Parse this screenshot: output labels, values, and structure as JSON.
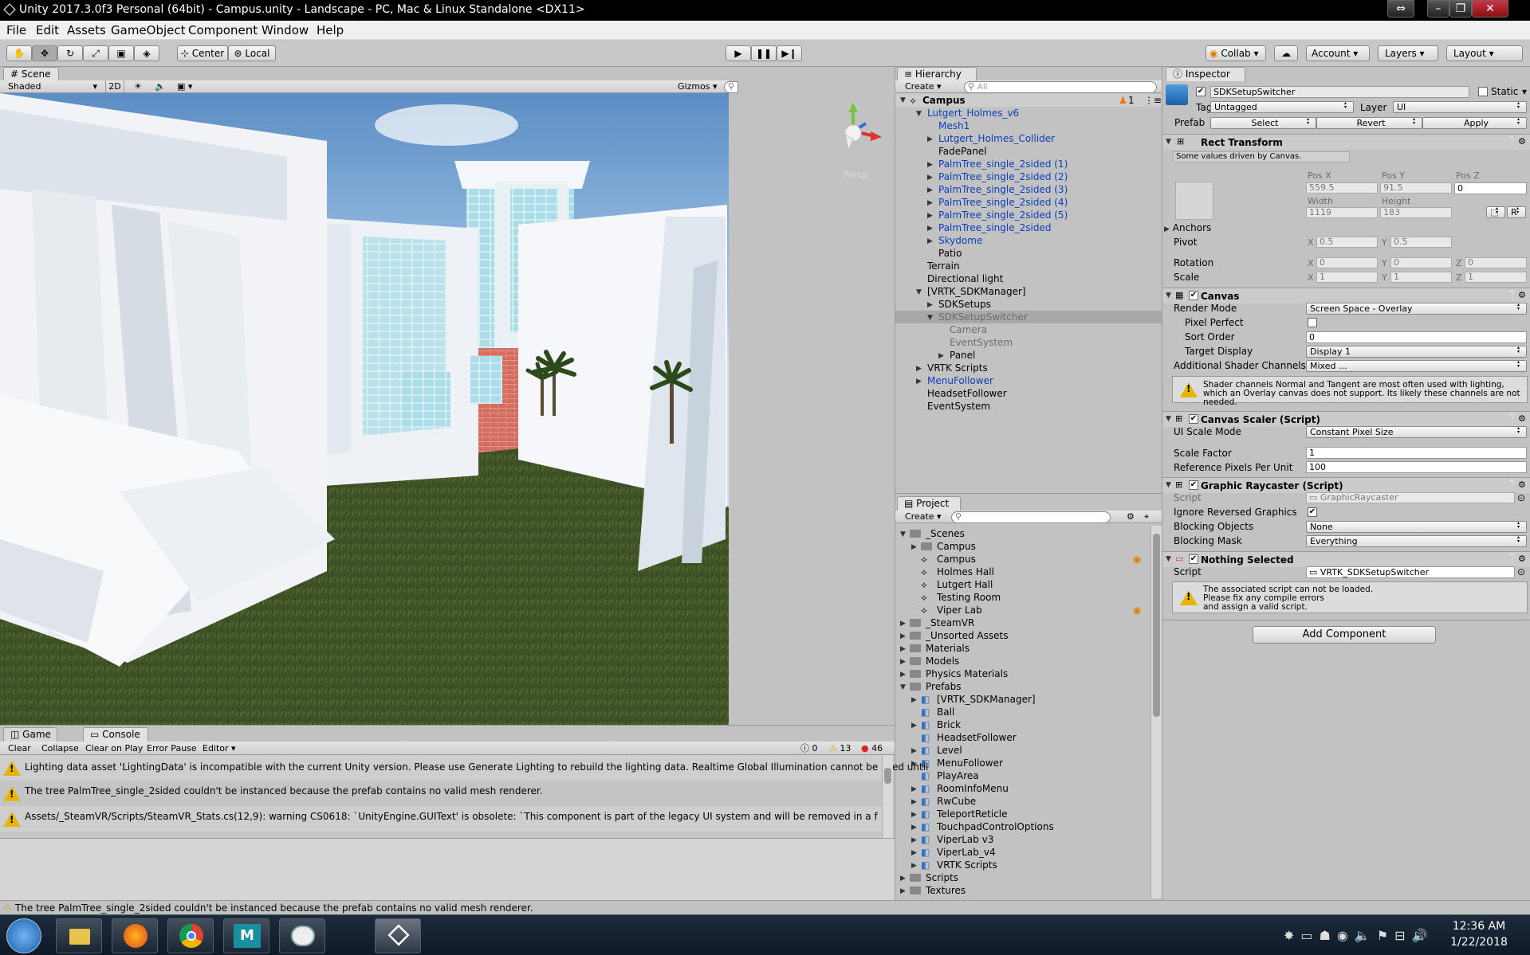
{
  "window": {
    "title": "Unity 2017.3.0f3 Personal (64bit) - Campus.unity - Landscape - PC, Mac & Linux Standalone <DX11>"
  },
  "menu": [
    "File",
    "Edit",
    "Assets",
    "GameObject",
    "Component",
    "Window",
    "Help"
  ],
  "toolbar": {
    "center": "Center",
    "local": "Local",
    "collab": "Collab",
    "account": "Account",
    "layers": "Layers",
    "layout": "Layout"
  },
  "scene": {
    "tab": "Scene",
    "shading": "Shaded",
    "mode2d": "2D",
    "gizmos": "Gizmos",
    "search": "All",
    "persp": "Persp"
  },
  "hierarchy": {
    "tab": "Hierarchy",
    "create": "Create",
    "search": "All",
    "scene_name": "Campus",
    "badge": "1",
    "items": [
      {
        "label": "Lutgert_Holmes_v6",
        "indent": 1,
        "arrow": "open",
        "color": "blue"
      },
      {
        "label": "Mesh1",
        "indent": 2,
        "arrow": "",
        "color": "blue"
      },
      {
        "label": "Lutgert_Holmes_Collider",
        "indent": 2,
        "arrow": "closed",
        "color": "blue"
      },
      {
        "label": "FadePanel",
        "indent": 2,
        "arrow": "",
        "color": "black"
      },
      {
        "label": "PalmTree_single_2sided (1)",
        "indent": 2,
        "arrow": "closed",
        "color": "blue"
      },
      {
        "label": "PalmTree_single_2sided (2)",
        "indent": 2,
        "arrow": "closed",
        "color": "blue"
      },
      {
        "label": "PalmTree_single_2sided (3)",
        "indent": 2,
        "arrow": "closed",
        "color": "blue"
      },
      {
        "label": "PalmTree_single_2sided (4)",
        "indent": 2,
        "arrow": "closed",
        "color": "blue"
      },
      {
        "label": "PalmTree_single_2sided (5)",
        "indent": 2,
        "arrow": "closed",
        "color": "blue"
      },
      {
        "label": "PalmTree_single_2sided",
        "indent": 2,
        "arrow": "closed",
        "color": "blue"
      },
      {
        "label": "Skydome",
        "indent": 2,
        "arrow": "closed",
        "color": "blue"
      },
      {
        "label": "Patio",
        "indent": 2,
        "arrow": "",
        "color": "black"
      },
      {
        "label": "Terrain",
        "indent": 1,
        "arrow": "",
        "color": "black"
      },
      {
        "label": "Directional light",
        "indent": 1,
        "arrow": "",
        "color": "black"
      },
      {
        "label": "[VRTK_SDKManager]",
        "indent": 1,
        "arrow": "open",
        "color": "black"
      },
      {
        "label": "SDKSetups",
        "indent": 2,
        "arrow": "closed",
        "color": "black"
      },
      {
        "label": "SDKSetupSwitcher",
        "indent": 2,
        "arrow": "open",
        "color": "gray",
        "selected": true
      },
      {
        "label": "Camera",
        "indent": 3,
        "arrow": "",
        "color": "gray"
      },
      {
        "label": "EventSystem",
        "indent": 3,
        "arrow": "",
        "color": "gray"
      },
      {
        "label": "Panel",
        "indent": 3,
        "arrow": "closed",
        "color": "black"
      },
      {
        "label": "VRTK Scripts",
        "indent": 1,
        "arrow": "closed",
        "color": "black"
      },
      {
        "label": "MenuFollower",
        "indent": 1,
        "arrow": "closed",
        "color": "blue"
      },
      {
        "label": "HeadsetFollower",
        "indent": 1,
        "arrow": "",
        "color": "black"
      },
      {
        "label": "EventSystem",
        "indent": 1,
        "arrow": "",
        "color": "black"
      }
    ]
  },
  "project": {
    "tab": "Project",
    "create": "Create",
    "items": [
      {
        "label": "_Scenes",
        "indent": 0,
        "arrow": "open",
        "icon": "folder"
      },
      {
        "label": "Campus",
        "indent": 1,
        "arrow": "closed",
        "icon": "folder"
      },
      {
        "label": "Campus",
        "indent": 1,
        "arrow": "",
        "icon": "unity",
        "collab": true
      },
      {
        "label": "Holmes Hall",
        "indent": 1,
        "arrow": "",
        "icon": "unity"
      },
      {
        "label": "Lutgert Hall",
        "indent": 1,
        "arrow": "",
        "icon": "unity"
      },
      {
        "label": "Testing Room",
        "indent": 1,
        "arrow": "",
        "icon": "unity"
      },
      {
        "label": "Viper Lab",
        "indent": 1,
        "arrow": "",
        "icon": "unity",
        "collab": true
      },
      {
        "label": "_SteamVR",
        "indent": 0,
        "arrow": "closed",
        "icon": "folder"
      },
      {
        "label": "_Unsorted Assets",
        "indent": 0,
        "arrow": "closed",
        "icon": "folder"
      },
      {
        "label": "Materials",
        "indent": 0,
        "arrow": "closed",
        "icon": "folder"
      },
      {
        "label": "Models",
        "indent": 0,
        "arrow": "closed",
        "icon": "folder"
      },
      {
        "label": "Physics Materials",
        "indent": 0,
        "arrow": "closed",
        "icon": "folder"
      },
      {
        "label": "Prefabs",
        "indent": 0,
        "arrow": "open",
        "icon": "folder"
      },
      {
        "label": "[VRTK_SDKManager]",
        "indent": 1,
        "arrow": "closed",
        "icon": "prefab"
      },
      {
        "label": "Ball",
        "indent": 1,
        "arrow": "",
        "icon": "prefab"
      },
      {
        "label": "Brick",
        "indent": 1,
        "arrow": "closed",
        "icon": "prefab"
      },
      {
        "label": "HeadsetFollower",
        "indent": 1,
        "arrow": "",
        "icon": "prefab"
      },
      {
        "label": "Level",
        "indent": 1,
        "arrow": "closed",
        "icon": "prefab"
      },
      {
        "label": "MenuFollower",
        "indent": 1,
        "arrow": "closed",
        "icon": "prefab"
      },
      {
        "label": "PlayArea",
        "indent": 1,
        "arrow": "",
        "icon": "prefab"
      },
      {
        "label": "RoomInfoMenu",
        "indent": 1,
        "arrow": "closed",
        "icon": "prefab"
      },
      {
        "label": "RwCube",
        "indent": 1,
        "arrow": "closed",
        "icon": "prefab"
      },
      {
        "label": "TeleportReticle",
        "indent": 1,
        "arrow": "closed",
        "icon": "prefab"
      },
      {
        "label": "TouchpadControlOptions",
        "indent": 1,
        "arrow": "closed",
        "icon": "prefab"
      },
      {
        "label": "ViperLab v3",
        "indent": 1,
        "arrow": "closed",
        "icon": "prefab"
      },
      {
        "label": "ViperLab_v4",
        "indent": 1,
        "arrow": "closed",
        "icon": "prefab"
      },
      {
        "label": "VRTK Scripts",
        "indent": 1,
        "arrow": "closed",
        "icon": "prefab"
      },
      {
        "label": "Scripts",
        "indent": 0,
        "arrow": "closed",
        "icon": "folder"
      },
      {
        "label": "Textures",
        "indent": 0,
        "arrow": "closed",
        "icon": "folder"
      }
    ]
  },
  "console": {
    "game_tab": "Game",
    "console_tab": "Console",
    "clear": "Clear",
    "collapse": "Collapse",
    "clear_on_play": "Clear on Play",
    "error_pause": "Error Pause",
    "editor": "Editor",
    "info_count": "0",
    "warn_count": "13",
    "error_count": "46",
    "messages": [
      "Lighting data asset 'LightingData' is incompatible with the current Unity version. Please use Generate Lighting to rebuild the lighting data.  Realtime Global Illumination cannot be used until",
      "The tree PalmTree_single_2sided couldn't be instanced because the prefab contains no valid mesh renderer.",
      "Assets/_SteamVR/Scripts/SteamVR_Stats.cs(12,9): warning CS0618: `UnityEngine.GUIText' is obsolete: `This component is part of the legacy UI system and will be removed in a future r"
    ]
  },
  "inspector": {
    "tab": "Inspector",
    "object_name": "SDKSetupSwitcher",
    "static": "Static",
    "tag_label": "Tag",
    "tag": "Untagged",
    "layer_label": "Layer",
    "layer": "UI",
    "prefab_label": "Prefab",
    "select": "Select",
    "revert": "Revert",
    "apply": "Apply",
    "rect": {
      "title": "Rect Transform",
      "note": "Some values driven by Canvas.",
      "posx_label": "Pos X",
      "posy_label": "Pos Y",
      "posz_label": "Pos Z",
      "posx": "559.5",
      "posy": "91.5",
      "posz": "0",
      "width_label": "Width",
      "height_label": "Height",
      "width": "1119",
      "height": "183",
      "anchors": "Anchors",
      "pivot": "Pivot",
      "pivot_x": "0.5",
      "pivot_y": "0.5",
      "rotation": "Rotation",
      "rot_x": "0",
      "rot_y": "0",
      "rot_z": "0",
      "scale": "Scale",
      "scale_x": "1",
      "scale_y": "1",
      "scale_z": "1",
      "x": "X",
      "y": "Y",
      "z": "Z",
      "r": "R"
    },
    "canvas": {
      "title": "Canvas",
      "render_mode_label": "Render Mode",
      "render_mode": "Screen Space - Overlay",
      "pixel_perfect": "Pixel Perfect",
      "sort_order_label": "Sort Order",
      "sort_order": "0",
      "target_display_label": "Target Display",
      "target_display": "Display 1",
      "shader_label": "Additional Shader Channels",
      "shader": "Mixed ...",
      "warning": "Shader channels Normal and Tangent are most often used with lighting, which an Overlay canvas does not support. Its likely these channels are not needed."
    },
    "scaler": {
      "title": "Canvas Scaler (Script)",
      "mode_label": "UI Scale Mode",
      "mode": "Constant Pixel Size",
      "factor_label": "Scale Factor",
      "factor": "1",
      "ppu_label": "Reference Pixels Per Unit",
      "ppu": "100"
    },
    "raycaster": {
      "title": "Graphic Raycaster (Script)",
      "script_label": "Script",
      "script": "GraphicRaycaster",
      "ignore_label": "Ignore Reversed Graphics",
      "blocking_label": "Blocking Objects",
      "blocking": "None",
      "mask_label": "Blocking Mask",
      "mask": "Everything"
    },
    "missing": {
      "title": "Nothing Selected",
      "script_label": "Script",
      "script": "VRTK_SDKSetupSwitcher",
      "warning_lines": [
        "The associated script can not be loaded.",
        "Please fix any compile errors",
        "and assign a valid script."
      ]
    },
    "add_component": "Add Component"
  },
  "statusbar": "The tree PalmTree_single_2sided couldn't be instanced because the prefab contains no valid mesh renderer.",
  "taskbar": {
    "time": "12:36 AM",
    "date": "1/22/2018",
    "apps": [
      "Start",
      "File Explorer",
      "Firefox",
      "Chrome",
      "Maya",
      "Paint",
      "Unity"
    ]
  }
}
